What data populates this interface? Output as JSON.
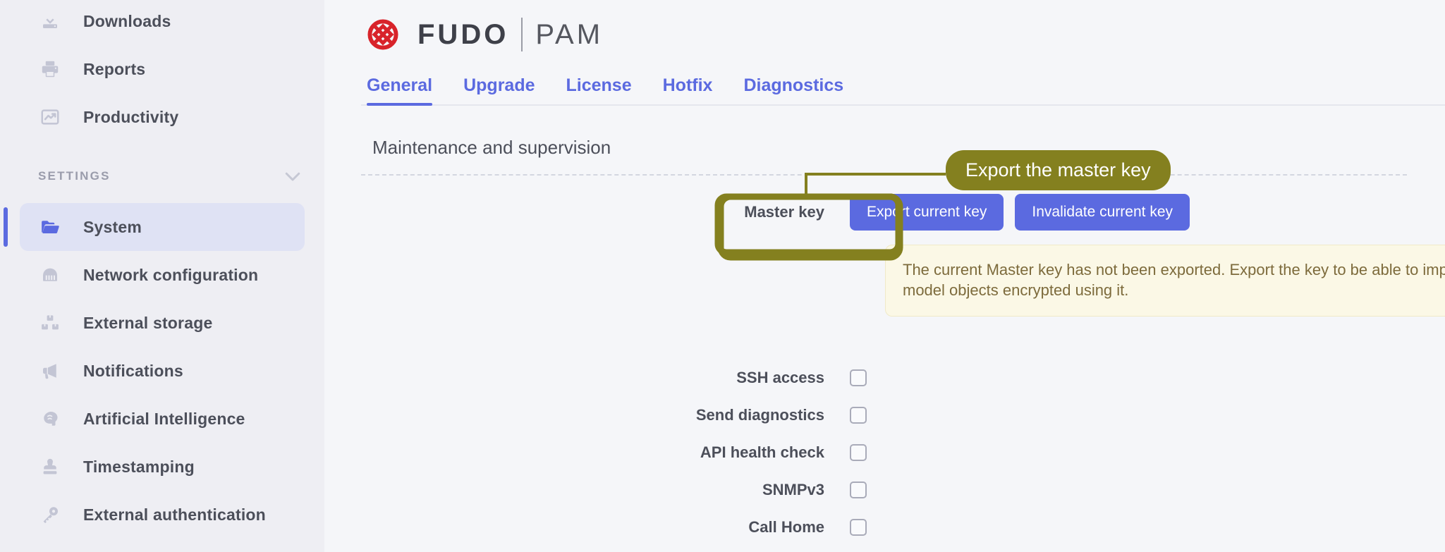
{
  "sidebar": {
    "items": [
      {
        "label": "Downloads",
        "icon": "download-icon",
        "active": false
      },
      {
        "label": "Reports",
        "icon": "printer-icon",
        "active": false
      },
      {
        "label": "Productivity",
        "icon": "chart-line-icon",
        "active": false
      }
    ],
    "section": {
      "label": "SETTINGS",
      "chevron_icon": "chevron-down-icon"
    },
    "settings_items": [
      {
        "label": "System",
        "icon": "folder-icon",
        "active": true
      },
      {
        "label": "Network configuration",
        "icon": "network-port-icon",
        "active": false
      },
      {
        "label": "External storage",
        "icon": "storage-boxes-icon",
        "active": false
      },
      {
        "label": "Notifications",
        "icon": "megaphone-icon",
        "active": false
      },
      {
        "label": "Artificial Intelligence",
        "icon": "brain-head-icon",
        "active": false
      },
      {
        "label": "Timestamping",
        "icon": "stamp-icon",
        "active": false
      },
      {
        "label": "External authentication",
        "icon": "key-icon",
        "active": false
      }
    ]
  },
  "brand": {
    "name": "FUDO",
    "product": "PAM",
    "logo_icon": "fudo-knot-logo"
  },
  "tabs": [
    {
      "label": "General",
      "active": true
    },
    {
      "label": "Upgrade",
      "active": false
    },
    {
      "label": "License",
      "active": false
    },
    {
      "label": "Hotfix",
      "active": false
    },
    {
      "label": "Diagnostics",
      "active": false
    }
  ],
  "main": {
    "section_title": "Maintenance and supervision",
    "master_key": {
      "label": "Master key",
      "export_button": "Export current key",
      "invalidate_button": "Invalidate current key",
      "warning": "The current Master key has not been exported. Export the key to be able to import configuration settings and data model objects encrypted using it."
    },
    "checkboxes": [
      {
        "label": "SSH access",
        "checked": false
      },
      {
        "label": "Send diagnostics",
        "checked": false
      },
      {
        "label": "API health check",
        "checked": false
      },
      {
        "label": "SNMPv3",
        "checked": false
      },
      {
        "label": "Call Home",
        "checked": false
      }
    ]
  },
  "annotation": {
    "callout_label": "Export the master key",
    "callout_color": "#84801f",
    "highlight_target": "Export current key"
  },
  "colors": {
    "accent_blue": "#5b6ae0",
    "sidebar_bg": "#eeeef3",
    "main_bg": "#f5f6f9",
    "active_item_bg": "#dfe2f4",
    "warning_bg": "#fbf8e6",
    "warning_text": "#7d6b3c",
    "annotation_olive": "#84801f",
    "logo_red": "#d8232a"
  }
}
